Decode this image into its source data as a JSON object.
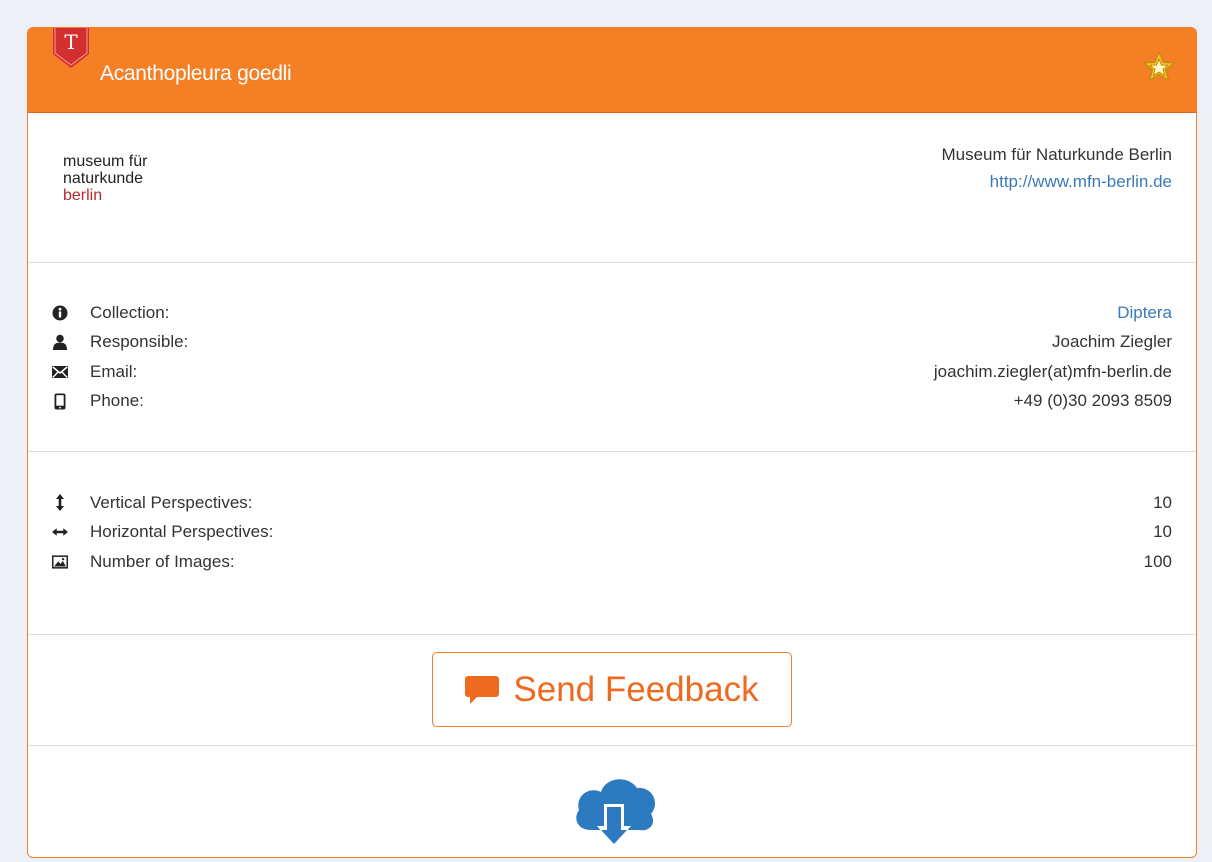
{
  "header": {
    "badge_letter": "T",
    "title": "Acanthopleura goedli",
    "favorite_icon": "star-icon",
    "colors": {
      "bar": "#f47f24",
      "badge": "#d32f2f",
      "star": "#f5c518"
    }
  },
  "museum": {
    "logo_lines": [
      "museum für",
      "naturkunde",
      "berlin"
    ],
    "name": "Museum für Naturkunde Berlin",
    "url": "http://www.mfn-berlin.de"
  },
  "contact": {
    "rows": [
      {
        "icon": "info-icon",
        "label": "Collection:",
        "value": "Diptera"
      },
      {
        "icon": "user-icon",
        "label": "Responsible:",
        "value": "Joachim Ziegler"
      },
      {
        "icon": "envelope-icon",
        "label": "Email:",
        "value": "joachim.ziegler(at)mfn-berlin.de"
      },
      {
        "icon": "phone-icon",
        "label": "Phone:",
        "value": "+49 (0)30 2093 8509"
      }
    ]
  },
  "perspectives": {
    "rows": [
      {
        "icon": "vertical-arrows-icon",
        "label": "Vertical Perspectives:",
        "value": "10"
      },
      {
        "icon": "horizontal-arrows-icon",
        "label": "Horizontal Perspectives:",
        "value": "10"
      },
      {
        "icon": "image-icon",
        "label": "Number of Images:",
        "value": "100"
      }
    ]
  },
  "feedback": {
    "label": "Send Feedback",
    "icon": "comment-icon",
    "color": "#ee6a1e"
  },
  "download": {
    "icon": "cloud-download-icon",
    "color": "#2c7bc1"
  }
}
